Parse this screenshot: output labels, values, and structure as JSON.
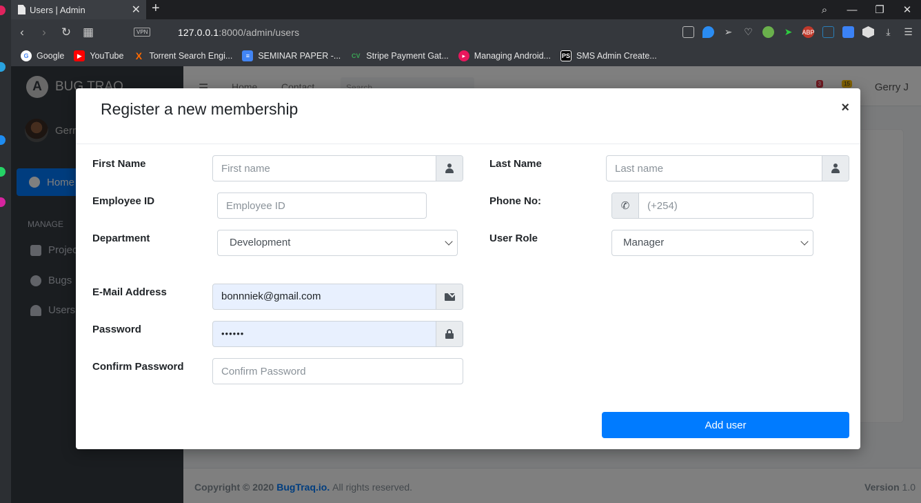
{
  "browser": {
    "tab_title": "Users | Admin",
    "url_host": "127.0.0.1",
    "url_path": ":8000/admin/users",
    "vpn_label": "VPN",
    "bookmarks": [
      {
        "label": "Google",
        "icon": "google-icon",
        "color": "#ffffff"
      },
      {
        "label": "YouTube",
        "icon": "youtube-icon",
        "color": "#ff0000"
      },
      {
        "label": "Torrent Search Engi...",
        "icon": "torrent-icon",
        "color": "#ff6a00"
      },
      {
        "label": "SEMINAR PAPER -...",
        "icon": "docs-icon",
        "color": "#4285f4"
      },
      {
        "label": "Stripe Payment Gat...",
        "icon": "cv-icon",
        "color": "#3aa655"
      },
      {
        "label": "Managing Android...",
        "icon": "video-icon",
        "color": "#e8175d"
      },
      {
        "label": "SMS Admin Create...",
        "icon": "ps-icon",
        "color": "#000000"
      }
    ],
    "extensions": {
      "abp": "ABP"
    }
  },
  "app": {
    "brand": "BUG TRAQ",
    "brand_letter": "A",
    "user_name": "Gerry",
    "nav_home": "Home",
    "nav_header": "MANAGE",
    "nav_items": [
      "Projects",
      "Bugs",
      "Users"
    ],
    "topnav_links": [
      "Home",
      "Contact"
    ],
    "search_placeholder": "Search",
    "topnav_user": "Gerry J",
    "msg_badge": "3",
    "notif_badge": "15",
    "footer": {
      "copyright": "Copyright © 2020",
      "brand_link": "BugTraq.io.",
      "rights": "All rights reserved.",
      "version_label": "Version",
      "version_value": "1.0"
    }
  },
  "modal": {
    "title": "Register a new membership",
    "close": "×",
    "first_name": {
      "label": "First Name",
      "placeholder": "First name",
      "value": ""
    },
    "last_name": {
      "label": "Last Name",
      "placeholder": "Last name",
      "value": ""
    },
    "employee_id": {
      "label": "Employee ID",
      "placeholder": "Employee ID",
      "value": ""
    },
    "phone": {
      "label": "Phone No:",
      "placeholder": "(+254)",
      "value": ""
    },
    "department": {
      "label": "Department",
      "selected": "Development"
    },
    "user_role": {
      "label": "User Role",
      "selected": "Manager"
    },
    "email": {
      "label": "E-Mail Address",
      "placeholder": "",
      "value": "bonnniek@gmail.com"
    },
    "password": {
      "label": "Password",
      "value": "••••••"
    },
    "confirm_password": {
      "label": "Confirm Password",
      "placeholder": "Confirm Password",
      "value": ""
    },
    "submit_label": "Add user"
  }
}
